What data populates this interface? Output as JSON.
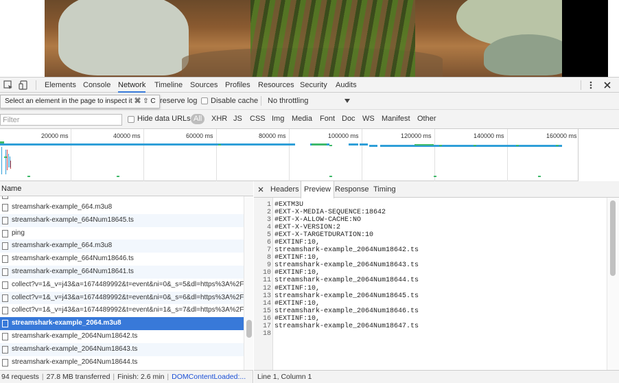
{
  "toolbar": {
    "tabs": [
      "Elements",
      "Console",
      "Network",
      "Timeline",
      "Sources",
      "Profiles",
      "Resources",
      "Security",
      "Audits"
    ],
    "active_tab": "Network",
    "more_icon": "vertical-ellipsis-icon",
    "close_icon": "close-icon"
  },
  "toolbar2": {
    "tooltip": "Select an element in the page to inspect it  ⌘ ⇧ C",
    "preserve_log": "reserve log",
    "disable_cache": "Disable cache",
    "throttling": "No throttling"
  },
  "filterbar": {
    "filter_placeholder": "Filter",
    "hide_data_urls": "Hide data URLs",
    "types": [
      "All",
      "XHR",
      "JS",
      "CSS",
      "Img",
      "Media",
      "Font",
      "Doc",
      "WS",
      "Manifest",
      "Other"
    ]
  },
  "overview": {
    "ticks": [
      "20000 ms",
      "40000 ms",
      "60000 ms",
      "80000 ms",
      "100000 ms",
      "120000 ms",
      "140000 ms",
      "160000 ms"
    ]
  },
  "requests": {
    "header": "Name",
    "rows": [
      "streamshark-example_664.m3u8",
      "streamshark-example_664Num18645.ts",
      "ping",
      "streamshark-example_664.m3u8",
      "streamshark-example_664Num18646.ts",
      "streamshark-example_664Num18641.ts",
      "collect?v=1&_v=j43&a=1674489992&t=event&ni=0&_s=5&dl=https%3A%2F%",
      "collect?v=1&_v=j43&a=1674489992&t=event&ni=0&_s=6&dl=https%3A%2F%",
      "collect?v=1&_v=j43&a=1674489992&t=event&ni=1&_s=7&dl=https%3A%2F%",
      "streamshark-example_2064.m3u8",
      "streamshark-example_2064Num18642.ts",
      "streamshark-example_2064Num18643.ts",
      "streamshark-example_2064Num18644.ts"
    ],
    "selected_index": 9
  },
  "detail": {
    "tabs": [
      "Headers",
      "Preview",
      "Response",
      "Timing"
    ],
    "active_tab": "Preview",
    "lines": [
      "#EXTM3U",
      "#EXT-X-MEDIA-SEQUENCE:18642",
      "#EXT-X-ALLOW-CACHE:NO",
      "#EXT-X-VERSION:2",
      "#EXT-X-TARGETDURATION:10",
      "#EXTINF:10,",
      "streamshark-example_2064Num18642.ts",
      "#EXTINF:10,",
      "streamshark-example_2064Num18643.ts",
      "#EXTINF:10,",
      "streamshark-example_2064Num18644.ts",
      "#EXTINF:10,",
      "streamshark-example_2064Num18645.ts",
      "#EXTINF:10,",
      "streamshark-example_2064Num18646.ts",
      "#EXTINF:10,",
      "streamshark-example_2064Num18647.ts",
      ""
    ]
  },
  "status": {
    "requests": "94 requests",
    "transferred": "27.8 MB transferred",
    "finish": "Finish: 2.6 min",
    "dom": "DOMContentLoaded:...",
    "cursor": "Line 1, Column 1"
  },
  "colors": {
    "accent": "#3879d9",
    "selected_row": "#3879d9",
    "overview_bar": "#2f9fd8",
    "overview_green": "#3fb96a"
  }
}
